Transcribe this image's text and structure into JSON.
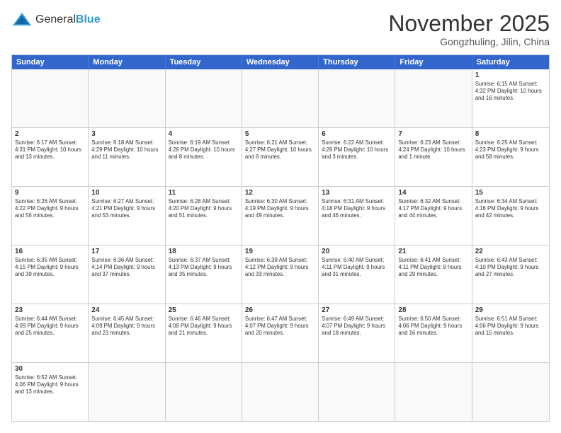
{
  "logo": {
    "general": "General",
    "blue": "Blue"
  },
  "title": "November 2025",
  "location": "Gongzhuling, Jilin, China",
  "header_days": [
    "Sunday",
    "Monday",
    "Tuesday",
    "Wednesday",
    "Thursday",
    "Friday",
    "Saturday"
  ],
  "weeks": [
    [
      {
        "day": "",
        "info": ""
      },
      {
        "day": "",
        "info": ""
      },
      {
        "day": "",
        "info": ""
      },
      {
        "day": "",
        "info": ""
      },
      {
        "day": "",
        "info": ""
      },
      {
        "day": "",
        "info": ""
      },
      {
        "day": "1",
        "info": "Sunrise: 6:15 AM\nSunset: 4:32 PM\nDaylight: 10 hours and 16 minutes."
      }
    ],
    [
      {
        "day": "2",
        "info": "Sunrise: 6:17 AM\nSunset: 4:31 PM\nDaylight: 10 hours and 13 minutes."
      },
      {
        "day": "3",
        "info": "Sunrise: 6:18 AM\nSunset: 4:29 PM\nDaylight: 10 hours and 11 minutes."
      },
      {
        "day": "4",
        "info": "Sunrise: 6:19 AM\nSunset: 4:28 PM\nDaylight: 10 hours and 8 minutes."
      },
      {
        "day": "5",
        "info": "Sunrise: 6:21 AM\nSunset: 4:27 PM\nDaylight: 10 hours and 6 minutes."
      },
      {
        "day": "6",
        "info": "Sunrise: 6:22 AM\nSunset: 4:26 PM\nDaylight: 10 hours and 3 minutes."
      },
      {
        "day": "7",
        "info": "Sunrise: 6:23 AM\nSunset: 4:24 PM\nDaylight: 10 hours and 1 minute."
      },
      {
        "day": "8",
        "info": "Sunrise: 6:25 AM\nSunset: 4:23 PM\nDaylight: 9 hours and 58 minutes."
      }
    ],
    [
      {
        "day": "9",
        "info": "Sunrise: 6:26 AM\nSunset: 4:22 PM\nDaylight: 9 hours and 56 minutes."
      },
      {
        "day": "10",
        "info": "Sunrise: 6:27 AM\nSunset: 4:21 PM\nDaylight: 9 hours and 53 minutes."
      },
      {
        "day": "11",
        "info": "Sunrise: 6:28 AM\nSunset: 4:20 PM\nDaylight: 9 hours and 51 minutes."
      },
      {
        "day": "12",
        "info": "Sunrise: 6:30 AM\nSunset: 4:19 PM\nDaylight: 9 hours and 49 minutes."
      },
      {
        "day": "13",
        "info": "Sunrise: 6:31 AM\nSunset: 4:18 PM\nDaylight: 9 hours and 46 minutes."
      },
      {
        "day": "14",
        "info": "Sunrise: 6:32 AM\nSunset: 4:17 PM\nDaylight: 9 hours and 44 minutes."
      },
      {
        "day": "15",
        "info": "Sunrise: 6:34 AM\nSunset: 4:16 PM\nDaylight: 9 hours and 42 minutes."
      }
    ],
    [
      {
        "day": "16",
        "info": "Sunrise: 6:35 AM\nSunset: 4:15 PM\nDaylight: 9 hours and 39 minutes."
      },
      {
        "day": "17",
        "info": "Sunrise: 6:36 AM\nSunset: 4:14 PM\nDaylight: 9 hours and 37 minutes."
      },
      {
        "day": "18",
        "info": "Sunrise: 6:37 AM\nSunset: 4:13 PM\nDaylight: 9 hours and 35 minutes."
      },
      {
        "day": "19",
        "info": "Sunrise: 6:39 AM\nSunset: 4:12 PM\nDaylight: 9 hours and 33 minutes."
      },
      {
        "day": "20",
        "info": "Sunrise: 6:40 AM\nSunset: 4:11 PM\nDaylight: 9 hours and 31 minutes."
      },
      {
        "day": "21",
        "info": "Sunrise: 6:41 AM\nSunset: 4:11 PM\nDaylight: 9 hours and 29 minutes."
      },
      {
        "day": "22",
        "info": "Sunrise: 6:43 AM\nSunset: 4:10 PM\nDaylight: 9 hours and 27 minutes."
      }
    ],
    [
      {
        "day": "23",
        "info": "Sunrise: 6:44 AM\nSunset: 4:09 PM\nDaylight: 9 hours and 25 minutes."
      },
      {
        "day": "24",
        "info": "Sunrise: 6:45 AM\nSunset: 4:09 PM\nDaylight: 9 hours and 23 minutes."
      },
      {
        "day": "25",
        "info": "Sunrise: 6:46 AM\nSunset: 4:08 PM\nDaylight: 9 hours and 21 minutes."
      },
      {
        "day": "26",
        "info": "Sunrise: 6:47 AM\nSunset: 4:07 PM\nDaylight: 9 hours and 20 minutes."
      },
      {
        "day": "27",
        "info": "Sunrise: 6:49 AM\nSunset: 4:07 PM\nDaylight: 9 hours and 18 minutes."
      },
      {
        "day": "28",
        "info": "Sunrise: 6:50 AM\nSunset: 4:06 PM\nDaylight: 9 hours and 16 minutes."
      },
      {
        "day": "29",
        "info": "Sunrise: 6:51 AM\nSunset: 4:06 PM\nDaylight: 9 hours and 15 minutes."
      }
    ],
    [
      {
        "day": "30",
        "info": "Sunrise: 6:52 AM\nSunset: 4:06 PM\nDaylight: 9 hours and 13 minutes."
      },
      {
        "day": "",
        "info": ""
      },
      {
        "day": "",
        "info": ""
      },
      {
        "day": "",
        "info": ""
      },
      {
        "day": "",
        "info": ""
      },
      {
        "day": "",
        "info": ""
      },
      {
        "day": "",
        "info": ""
      }
    ]
  ]
}
